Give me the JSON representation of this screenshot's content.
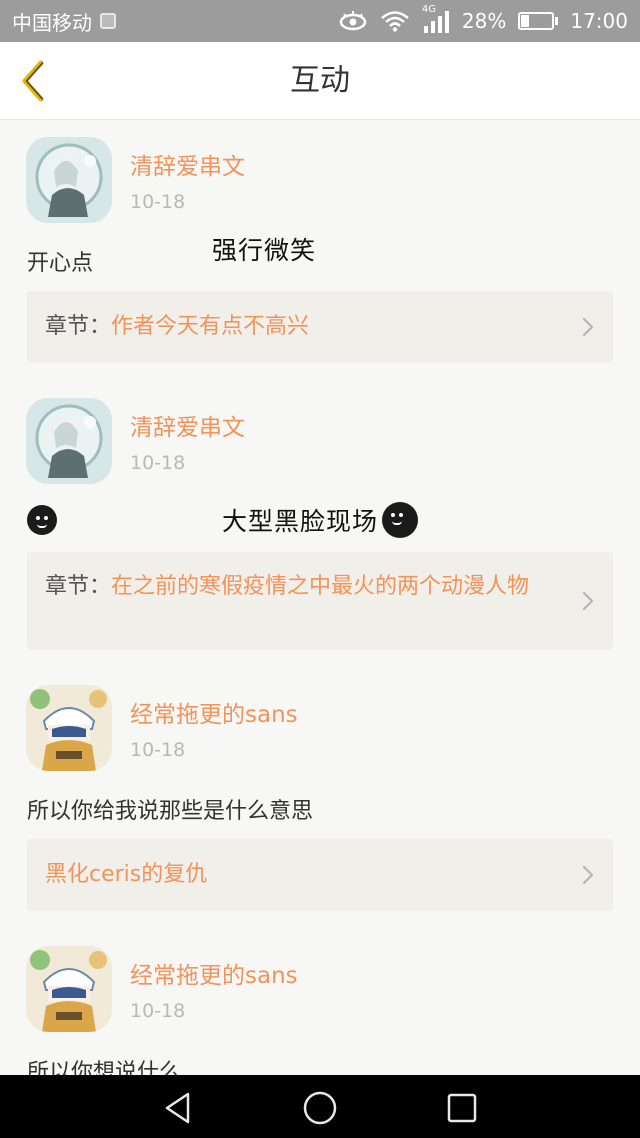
{
  "status_bar": {
    "carrier": "中国移动",
    "network": "4G",
    "battery": "28%",
    "battery_level": 0.28,
    "time": "17:00"
  },
  "header": {
    "title": "互动",
    "back_icon": "chevron-left-icon"
  },
  "items": [
    {
      "username": "清辞爱串文",
      "date": "10-18",
      "comment": "开心点",
      "overlay_text": "强行微笑",
      "chapter_prefix": "章节：",
      "chapter_name": "作者今天有点不高兴"
    },
    {
      "username": "清辞爱串文",
      "date": "10-18",
      "comment": "",
      "overlay_text": "大型黑脸现场",
      "chapter_prefix": "章节：",
      "chapter_name": "在之前的寒假疫情之中最火的两个动漫人物"
    },
    {
      "username": "经常拖更的sans",
      "date": "10-18",
      "comment": "所以你给我说那些是什么意思",
      "chapter_prefix": "",
      "chapter_name": "黑化ceris的复仇"
    },
    {
      "username": "经常拖更的sans",
      "date": "10-18",
      "comment": "所以你想说什么"
    }
  ],
  "colors": {
    "accent": "#f2935a",
    "status_bar": "#9c9c9c",
    "chapter_bg": "#f1efe9",
    "back_icon": "#e6b300"
  }
}
